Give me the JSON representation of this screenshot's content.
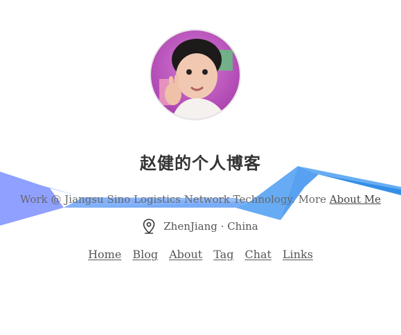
{
  "site": {
    "title": "赵健的个人博客",
    "avatar_alt": "avatar",
    "description_prefix": "Work @ Jiangsu Sino Logistics Network Technology. More ",
    "about_link": "About Me",
    "location": "ZhenJiang · China",
    "location_icon": "map-pin-icon"
  },
  "nav": {
    "items": [
      {
        "label": "Home"
      },
      {
        "label": "Blog"
      },
      {
        "label": "About"
      },
      {
        "label": "Tag"
      },
      {
        "label": "Chat"
      },
      {
        "label": "Links"
      }
    ]
  },
  "colors": {
    "ribbon_light": "#8fb6ff",
    "ribbon_mid": "#6ea7f5",
    "ribbon_dark": "#3c8ee6",
    "ribbon_violet": "#8aa0ff",
    "text": "#555555",
    "title": "#333333"
  }
}
